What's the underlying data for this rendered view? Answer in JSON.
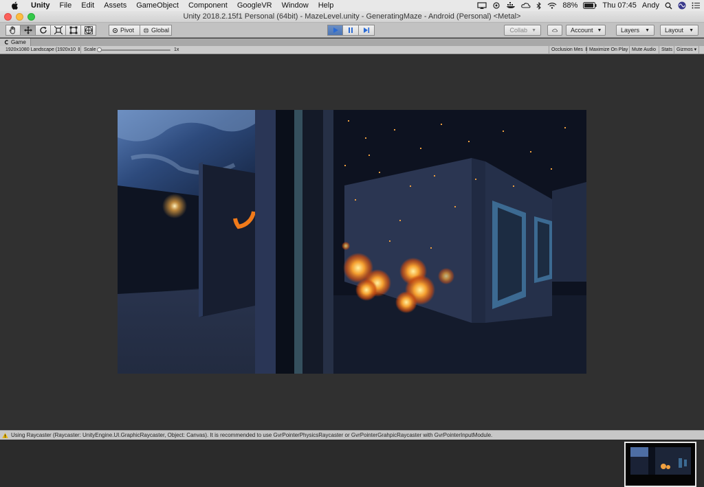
{
  "menubar": {
    "app_name": "Unity",
    "items": [
      "File",
      "Edit",
      "Assets",
      "GameObject",
      "Component",
      "GoogleVR",
      "Window",
      "Help"
    ],
    "battery": "88%",
    "clock": "Thu 07:45",
    "user": "Andy"
  },
  "window": {
    "title": "Unity 2018.2.15f1 Personal (64bit) - MazeLevel.unity - GeneratingMaze - Android (Personal) <Metal>"
  },
  "toolbar": {
    "pivot_label": "Pivot",
    "global_label": "Global",
    "collab_label": "Collab",
    "account_label": "Account",
    "layers_label": "Layers",
    "layout_label": "Layout",
    "play_state": "playing"
  },
  "game_tab": {
    "label": "Game",
    "resolution": "1920x1080 Landscape (1920x10",
    "scale_label": "Scale",
    "scale_value": "1x",
    "occlusion": "Occlusion Mes",
    "maximize": "Maximize On Play",
    "mute": "Mute Audio",
    "stats": "Stats",
    "gizmos": "Gizmos"
  },
  "status": {
    "message": "Using Raycaster (Raycaster: UnityEngine.UI.GraphicRaycaster, Object: Canvas). It is recommended to use GvrPointerPhysicsRaycaster or GvrPointerGrahpicRaycaster with GvrPointerInputModule."
  },
  "colors": {
    "accent_play": "#4d75b3",
    "warning": "#e8b400",
    "orange_reticle": "#f07a1a"
  }
}
